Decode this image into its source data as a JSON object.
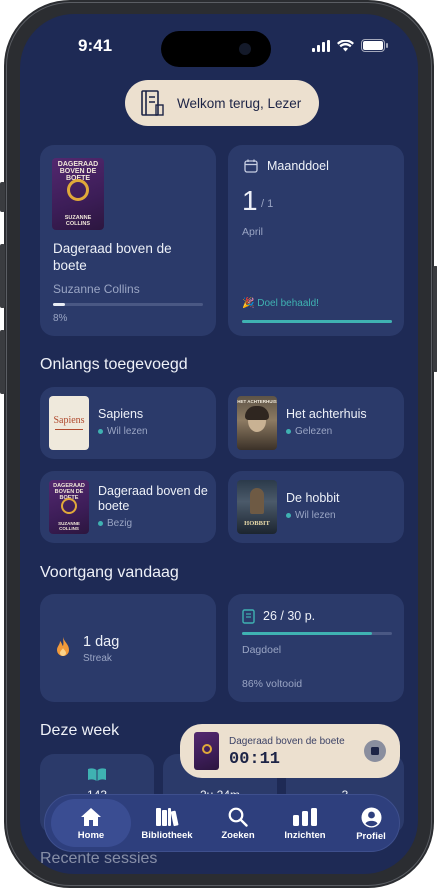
{
  "status": {
    "time": "9:41"
  },
  "welcome": {
    "label": "Welkom terug, Lezer"
  },
  "current_book": {
    "title": "Dageraad boven de boete",
    "author": "Suzanne Collins",
    "progress_label": "8%",
    "progress": 0.08,
    "cover_title": "DAGERAAD BOVEN DE BOETE",
    "cover_author": "SUZANNE COLLINS"
  },
  "monthly_goal": {
    "title": "Maanddoel",
    "count": "1",
    "total": "/ 1",
    "month": "April",
    "achieved": "🎉 Doel behaald!",
    "progress": 1.0
  },
  "recent": {
    "title": "Onlangs toegevoegd",
    "items": [
      {
        "title": "Sapiens",
        "status": "Wil lezen",
        "cover_title": "Sapiens"
      },
      {
        "title": "Het achterhuis",
        "status": "Gelezen",
        "cover_title": "HET ACHTERHUIS"
      },
      {
        "title": "Dageraad boven de boete",
        "status": "Bezig",
        "cover_title": "DAGERAAD BOVEN DE BOETE",
        "cover_author": "SUZANNE COLLINS"
      },
      {
        "title": "De hobbit",
        "status": "Wil lezen",
        "cover_title": "HOBBIT"
      }
    ]
  },
  "today": {
    "title": "Voortgang vandaag",
    "streak_value": "1 dag",
    "streak_label": "Streak",
    "pages": "26 / 30 p.",
    "pages_progress": 0.867,
    "goal_label": "Dagdoel",
    "completed": "86% voltooid"
  },
  "week": {
    "title": "Deze week",
    "stat1": "143",
    "stat2": "2u 24m",
    "stat3": "3"
  },
  "recent_sessions": {
    "title": "Recente sessies"
  },
  "player": {
    "title": "Dageraad boven de boete",
    "timer": "00:11"
  },
  "nav": {
    "items": [
      {
        "label": "Home"
      },
      {
        "label": "Bibliotheek"
      },
      {
        "label": "Zoeken"
      },
      {
        "label": "Inzichten"
      },
      {
        "label": "Profiel"
      }
    ]
  },
  "colors": {
    "background": "#1e2a55",
    "card": "#2b3a6a",
    "accent": "#3fb2b2",
    "cream": "#ece0cf",
    "flame": "#f29a3a"
  }
}
